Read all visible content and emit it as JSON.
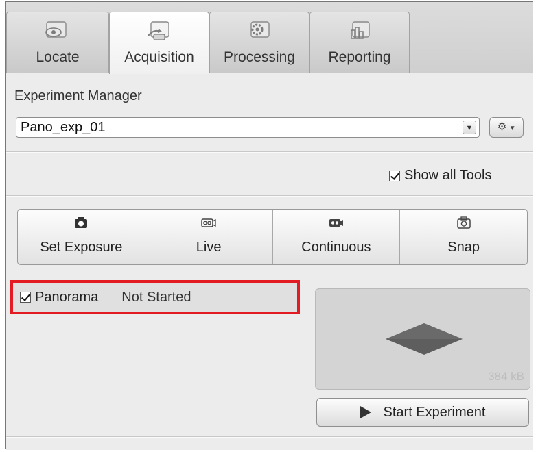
{
  "tabs": [
    {
      "label": "Locate",
      "icon": "locate-eye-icon",
      "active": false
    },
    {
      "label": "Acquisition",
      "icon": "acquisition-camera-icon",
      "active": true
    },
    {
      "label": "Processing",
      "icon": "processing-gear-icon",
      "active": false
    },
    {
      "label": "Reporting",
      "icon": "reporting-chart-icon",
      "active": false
    }
  ],
  "experiment_manager": {
    "title": "Experiment Manager",
    "selected": "Pano_exp_01",
    "dropdown_icon": "chevron-down-icon",
    "options_icon": "gear-icon"
  },
  "show_all_tools": {
    "label": "Show all Tools",
    "checked": true
  },
  "acquisition_buttons": [
    {
      "label": "Set Exposure",
      "icon": "camera-icon"
    },
    {
      "label": "Live",
      "icon": "live-camera-icon"
    },
    {
      "label": "Continuous",
      "icon": "continuous-camera-icon"
    },
    {
      "label": "Snap",
      "icon": "snap-camera-icon"
    }
  ],
  "panorama": {
    "label": "Panorama",
    "checked": true,
    "status": "Not Started"
  },
  "preview": {
    "size_text": "384 kB"
  },
  "start_button": {
    "label": "Start Experiment",
    "icon": "play-icon"
  },
  "colors": {
    "highlight": "#e31b23",
    "panel": "#ececec"
  }
}
